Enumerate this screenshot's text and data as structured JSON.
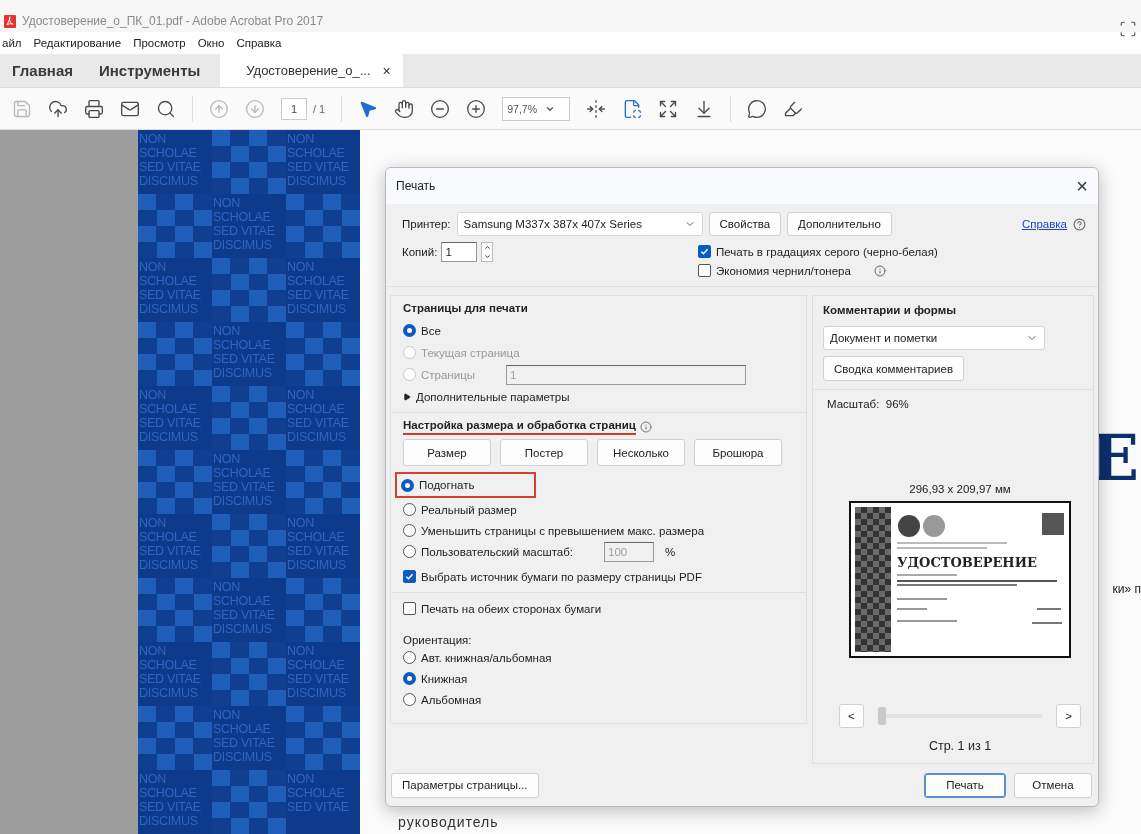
{
  "window": {
    "title": "Удостоверение_о_ПК_01.pdf - Adobe Acrobat Pro 2017"
  },
  "menu": [
    "айл",
    "Редактирование",
    "Просмотр",
    "Окно",
    "Справка"
  ],
  "tabs": [
    {
      "label": "Главная",
      "selected": false,
      "kind": "nav"
    },
    {
      "label": "Инструменты",
      "selected": false,
      "kind": "nav"
    },
    {
      "label": "Удостоверение_о_...",
      "selected": true,
      "kind": "document",
      "close": "×"
    }
  ],
  "toolbar": [
    {
      "kind": "save",
      "disabled": true,
      "active": false
    },
    {
      "kind": "upload",
      "disabled": false,
      "active": false
    },
    {
      "kind": "print",
      "disabled": false,
      "active": false
    },
    {
      "kind": "mail",
      "disabled": false,
      "active": false
    },
    {
      "kind": "search",
      "disabled": false,
      "active": false
    },
    {
      "kind": "separator"
    },
    {
      "kind": "page-up",
      "disabled": true,
      "active": false
    },
    {
      "kind": "page-down",
      "disabled": true,
      "active": false
    },
    {
      "kind": "page",
      "value": "1",
      "total": "/ 1"
    },
    {
      "kind": "separator"
    },
    {
      "kind": "pointer",
      "disabled": false,
      "active": true
    },
    {
      "kind": "hand",
      "disabled": false,
      "active": false
    },
    {
      "kind": "zoom-out",
      "disabled": false,
      "active": false
    },
    {
      "kind": "zoom-in",
      "disabled": false,
      "active": false
    },
    {
      "kind": "zoom",
      "value": "97,7%"
    },
    {
      "kind": "fit-width",
      "disabled": false,
      "active": false
    },
    {
      "kind": "fit-page",
      "disabled": false,
      "active": true
    },
    {
      "kind": "fullscreen",
      "disabled": false,
      "active": false
    },
    {
      "kind": "scroll-mode",
      "disabled": false,
      "active": false
    },
    {
      "kind": "separator"
    },
    {
      "kind": "comment",
      "disabled": false,
      "active": false
    },
    {
      "kind": "highlight",
      "disabled": false,
      "active": false
    }
  ],
  "document": {
    "mottos": [
      "NON\nSCHOLAE\nSED VITAE\nDISCIMUS",
      "NON\nSCHOLAE\nSED VITAE\nDISCIMUS",
      "NON\nSCHOLAE\nSED VITAE\nDISCIMUS",
      "NON\nSCHOLAE\nSED VITAE\nDISCIMUS",
      "NON\nSCHOLAE\nSED VITAE\nDISCIMUS",
      "NON\nSCHOLAE\nSED VITAE\nDISCIMUS",
      "NON\nSCHOLAE\nSED VITAE\nDISCIMUS",
      "NON\nSCHOLAE\nSED VITAE\nDISCIMUS",
      "NON\nSCHOLAE\nSED VITAE\nDISCIMUS",
      "NON\nSCHOLAE\nSED VITAE\nDISCIMUS",
      "NON\nSCHOLAE\nSED VITAE\nDISCIMUS",
      "NON\nSCHOLAE\nSED VITAE\nDISCIMUS",
      "NON\nSCHOLAE\nSED VITAE\nDISCIMUS",
      "NON\nSCHOLAE\nSED VITAE\nDISCIMUS",
      "NON\nSCHOLAE\nSED VITAE\nDISCIMUS",
      "NON\nSCHOLAE\nSED VITAE\nDISCIMUS",
      "NON\nSCHOLAE\nSED VITAE"
    ],
    "heading_letter": "Е",
    "side_text": "ки» п",
    "footer_text": "руководитель"
  },
  "dialog": {
    "title": "Печать",
    "close": "×",
    "printer": {
      "label": "Принтер:",
      "value": "Samsung M337x 387x 407x Series"
    },
    "top_buttons": [
      "Свойства",
      "Дополнительно"
    ],
    "help_link": "Справка",
    "copies": {
      "label": "Копий:",
      "value": "1"
    },
    "options": [
      {
        "label": "Печать в градациях серого (черно-белая)",
        "checked": true,
        "info": false
      },
      {
        "label": "Экономия чернил/тонера",
        "checked": false,
        "info": true
      }
    ],
    "pages": {
      "title": "Страницы для печати",
      "choices": [
        {
          "label": "Все",
          "selected": true,
          "disabled": false
        },
        {
          "label": "Текущая страница",
          "selected": false,
          "disabled": true
        },
        {
          "label": "Страницы",
          "selected": false,
          "disabled": true,
          "value": "1"
        }
      ],
      "more": "Дополнительные параметры"
    },
    "sizing": {
      "title": "Настройка размера и обработка страниц",
      "underlined": true,
      "modes": [
        "Размер",
        "Постер",
        "Несколько",
        "Брошюра"
      ],
      "choices": [
        {
          "label": "Подогнать",
          "selected": true,
          "highlighted": true
        },
        {
          "label": "Реальный размер",
          "selected": false,
          "highlighted": false
        },
        {
          "label": "Уменьшить страницы с превышением макс. размера",
          "selected": false,
          "highlighted": false
        },
        {
          "label": "Пользовательский масштаб:",
          "selected": false,
          "highlighted": false,
          "value": "100",
          "unit": "%"
        }
      ],
      "paper_source": {
        "label": "Выбрать источник бумаги по размеру страницы PDF",
        "checked": true
      }
    },
    "duplex": {
      "label": "Печать на обеих сторонах бумаги",
      "checked": false
    },
    "orientation": {
      "title": "Ориентация:",
      "choices": [
        {
          "label": "Авт. книжная/альбомная",
          "selected": false
        },
        {
          "label": "Книжная",
          "selected": true
        },
        {
          "label": "Альбомная",
          "selected": false
        }
      ]
    },
    "comments": {
      "title": "Комментарии и формы",
      "value": "Документ и пометки",
      "button": "Сводка комментариев"
    },
    "preview": {
      "scale": "Масштаб:  96%",
      "size": "296,93 x 209,97 мм",
      "doc_title": "УДОСТОВЕРЕНИЕ",
      "prev": "<",
      "next": ">",
      "level": 0,
      "page_label": "Стр. 1 из 1"
    },
    "page_setup": "Параметры страницы...",
    "actions": [
      {
        "label": "Печать",
        "default": true
      },
      {
        "label": "Отмена",
        "default": false
      }
    ]
  }
}
